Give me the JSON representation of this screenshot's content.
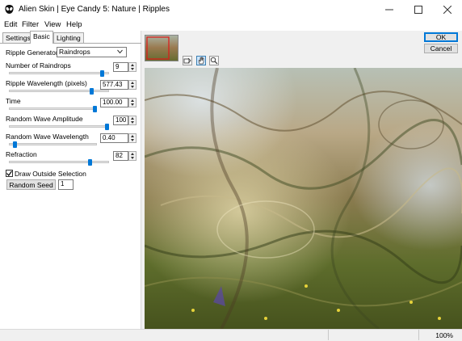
{
  "window": {
    "title": "Alien Skin | Eye Candy 5: Nature | Ripples",
    "app_icon": "alien-skin-logo-icon"
  },
  "menu": [
    "Edit",
    "Filter",
    "View",
    "Help"
  ],
  "tabs": {
    "settings": "Settings",
    "basic": "Basic",
    "lighting": "Lighting",
    "active": "Basic"
  },
  "controls": {
    "generator_label": "Ripple Generator:",
    "generator_value": "Raindrops",
    "params": [
      {
        "label": "Number of Raindrops",
        "value": "9",
        "level": 0.95
      },
      {
        "label": "Ripple Wavelength (pixels)",
        "value": "577.43",
        "level": 0.84
      },
      {
        "label": "Time",
        "value": "100.00",
        "level": 1.0
      },
      {
        "label": "Random Wave Amplitude",
        "value": "100",
        "level": 1.0
      },
      {
        "label": "Random Wave Wavelength",
        "value": "0.40",
        "level": 0.05
      },
      {
        "label": "Refraction",
        "value": "82",
        "level": 0.82
      }
    ],
    "draw_outside_label": "Draw Outside Selection",
    "draw_outside_checked": true,
    "random_seed_button": "Random Seed",
    "random_seed_value": "1"
  },
  "buttons": {
    "ok": "OK",
    "cancel": "Cancel"
  },
  "preview": {
    "tools": [
      "navigate-preview-icon",
      "hand-icon",
      "zoom-icon"
    ],
    "active_tool": "hand-icon"
  },
  "status": {
    "zoom": "100%"
  },
  "colors": {
    "accent": "#0078d7"
  }
}
